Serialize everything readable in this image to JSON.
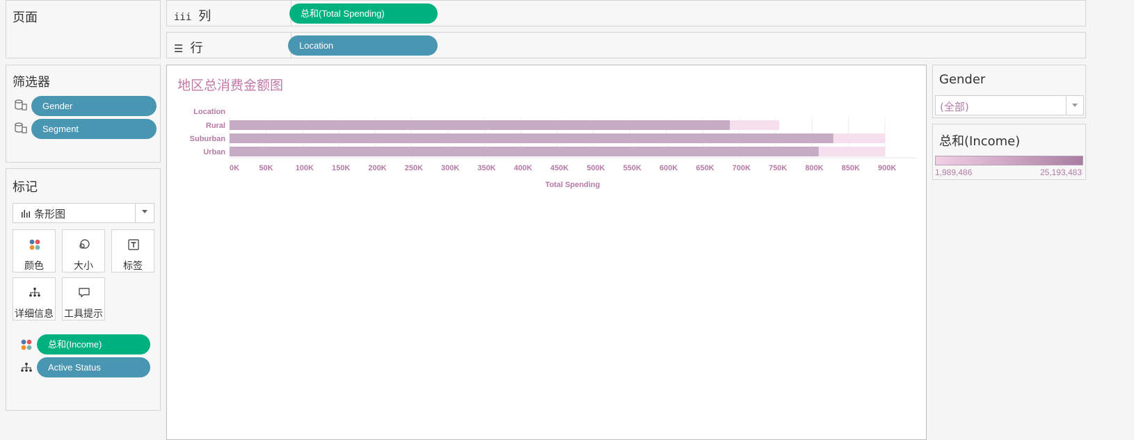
{
  "pages_panel": {
    "title": "页面"
  },
  "columns_shelf": {
    "label": "列",
    "pill": "总和(Total Spending)"
  },
  "rows_shelf": {
    "label": "行",
    "pill": "Location"
  },
  "filters_panel": {
    "title": "筛选器",
    "items": [
      {
        "label": "Gender"
      },
      {
        "label": "Segment"
      }
    ]
  },
  "marks_panel": {
    "title": "标记",
    "mark_type": "条形图",
    "cards": [
      {
        "label": "颜色",
        "icon": "color-icon"
      },
      {
        "label": "大小",
        "icon": "size-icon"
      },
      {
        "label": "标签",
        "icon": "label-icon"
      },
      {
        "label": "详细信息",
        "icon": "detail-icon"
      },
      {
        "label": "工具提示",
        "icon": "tooltip-icon"
      }
    ],
    "fields": [
      {
        "label": "总和(Income)",
        "icon": "color-icon",
        "color": "#00b180"
      },
      {
        "label": "Active Status",
        "icon": "detail-icon",
        "color": "#4996b2"
      }
    ]
  },
  "filter_card": {
    "title": "Gender",
    "selected": "(全部)"
  },
  "legend_card": {
    "title": "总和(Income)",
    "min_label": "1,989,486",
    "max_label": "25,193,483",
    "gradient_start": "#f1cfe4",
    "gradient_end": "#a97ea3"
  },
  "chart_data": {
    "type": "bar",
    "title": "地区总消费金额图",
    "row_header": "Location",
    "xlabel": "Total Spending",
    "categories": [
      "Rural",
      "Suburban",
      "Urban"
    ],
    "values": [
      687000,
      829000,
      809000
    ],
    "reference_values": [
      755000,
      900000,
      900000
    ],
    "xlim": [
      0,
      900000
    ],
    "ticks": [
      "0K",
      "50K",
      "100K",
      "150K",
      "200K",
      "250K",
      "300K",
      "350K",
      "400K",
      "450K",
      "500K",
      "550K",
      "600K",
      "650K",
      "700K",
      "750K",
      "800K",
      "850K",
      "900K"
    ],
    "bar_color": "#c4a8c2",
    "reference_color": "#f5dfee",
    "grid": true
  }
}
